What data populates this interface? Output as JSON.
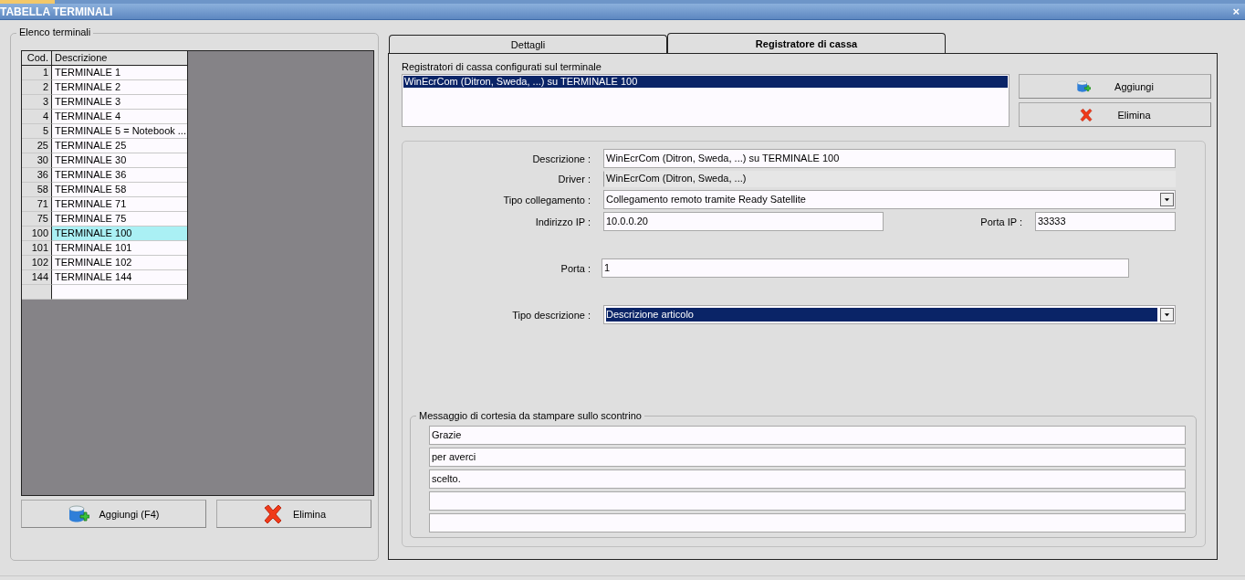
{
  "window": {
    "title": "TABELLA TERMINALI",
    "close": "×"
  },
  "terminals": {
    "legend": "Elenco terminali",
    "columns": [
      "Cod.",
      "Descrizione"
    ],
    "rows": [
      {
        "code": "1",
        "description": "TERMINALE 1",
        "selected": false
      },
      {
        "code": "2",
        "description": "TERMINALE 2",
        "selected": false
      },
      {
        "code": "3",
        "description": "TERMINALE 3",
        "selected": false
      },
      {
        "code": "4",
        "description": "TERMINALE 4",
        "selected": false
      },
      {
        "code": "5",
        "description": "TERMINALE 5 = Notebook ...",
        "selected": false
      },
      {
        "code": "25",
        "description": "TERMINALE 25",
        "selected": false
      },
      {
        "code": "30",
        "description": "TERMINALE 30",
        "selected": false
      },
      {
        "code": "36",
        "description": "TERMINALE 36",
        "selected": false
      },
      {
        "code": "58",
        "description": "TERMINALE 58",
        "selected": false
      },
      {
        "code": "71",
        "description": "TERMINALE 71",
        "selected": false
      },
      {
        "code": "75",
        "description": "TERMINALE 75",
        "selected": false
      },
      {
        "code": "100",
        "description": "TERMINALE 100",
        "selected": true
      },
      {
        "code": "101",
        "description": "TERMINALE 101",
        "selected": false
      },
      {
        "code": "102",
        "description": "TERMINALE 102",
        "selected": false
      },
      {
        "code": "144",
        "description": "TERMINALE 144",
        "selected": false
      }
    ],
    "buttons": [
      {
        "kind": "add",
        "label": "Aggiungi (F4)"
      },
      {
        "kind": "delete",
        "label": "Elimina"
      }
    ]
  },
  "tabs": [
    {
      "label": "Dettagli",
      "selected": false
    },
    {
      "label": "Registratore di cassa",
      "selected": true
    }
  ],
  "registers": {
    "label": "Registratori di cassa configurati sul terminale",
    "items": [
      {
        "label": "WinEcrCom (Ditron, Sweda, ...) su TERMINALE 100",
        "selected": true
      }
    ],
    "buttons": [
      {
        "kind": "add",
        "label": "Aggiungi"
      },
      {
        "kind": "delete",
        "label": "Elimina"
      }
    ]
  },
  "form": {
    "descrizione": {
      "label": "Descrizione :",
      "value": "WinEcrCom (Ditron, Sweda, ...) su TERMINALE 100"
    },
    "driver": {
      "label": "Driver :",
      "value": "WinEcrCom (Ditron, Sweda, ...)",
      "disabled": true
    },
    "tipo_collegamento": {
      "label": "Tipo collegamento :",
      "value": "Collegamento remoto tramite Ready Satellite",
      "focused": false
    },
    "indirizzo_ip": {
      "label": "Indirizzo IP :",
      "value": "10.0.0.20"
    },
    "porta_ip": {
      "label": "Porta IP :",
      "value": "33333"
    },
    "porta": {
      "label": "Porta :",
      "value": "1"
    },
    "tipo_descrizione": {
      "label": "Tipo descrizione :",
      "value": "Descrizione articolo",
      "focused": true
    }
  },
  "courtesy": {
    "legend": "Messaggio di cortesia da stampare sullo scontrino",
    "lines": [
      {
        "kind": "text",
        "text": "Grazie"
      },
      {
        "kind": "text",
        "text": "per averci"
      },
      {
        "kind": "text",
        "text": "scelto."
      },
      {
        "kind": "blank"
      },
      {
        "kind": "blank"
      }
    ]
  }
}
